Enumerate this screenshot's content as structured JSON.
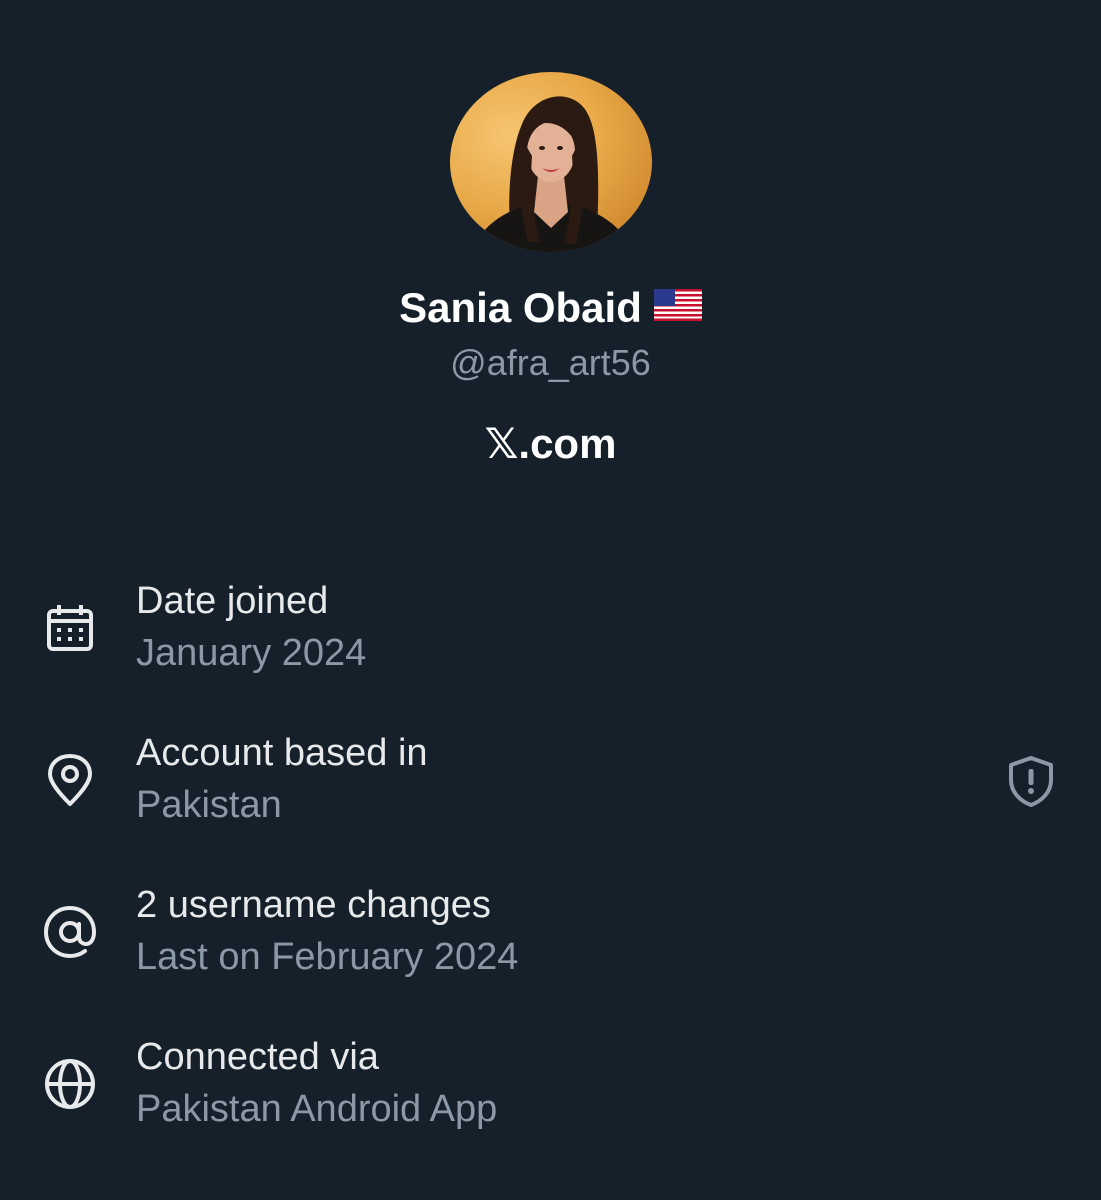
{
  "profile": {
    "display_name": "Sania Obaid",
    "flag_icon": "us-flag-icon",
    "handle": "@afra_art56",
    "domain": "𝕏.com"
  },
  "details": [
    {
      "icon": "calendar-icon",
      "title": "Date joined",
      "value": "January 2024"
    },
    {
      "icon": "location-pin-icon",
      "title": "Account based in",
      "value": "Pakistan",
      "trailing_icon": "shield-alert-icon"
    },
    {
      "icon": "at-sign-icon",
      "title": "2 username changes",
      "value": "Last on February 2024"
    },
    {
      "icon": "globe-icon",
      "title": "Connected via",
      "value": "Pakistan Android App"
    }
  ],
  "colors": {
    "background": "#15202b",
    "primary_text": "#e7e9ea",
    "secondary_text": "#8b98a5"
  }
}
